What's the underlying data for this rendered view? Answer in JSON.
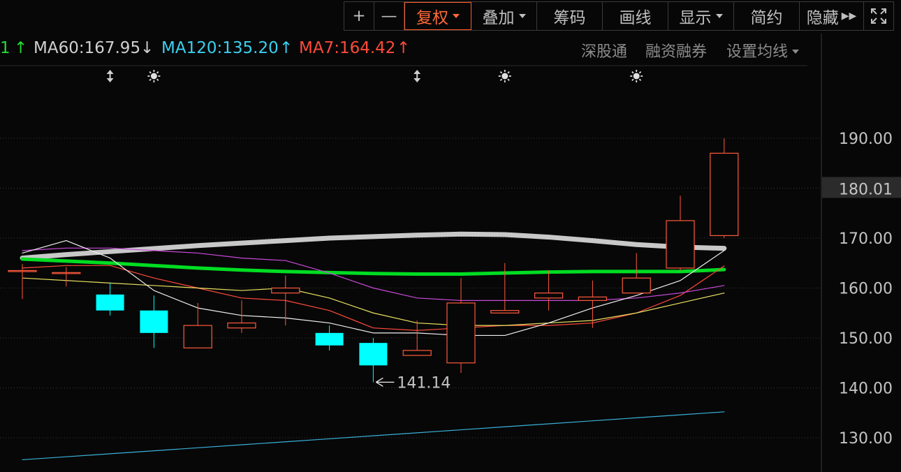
{
  "toolbar": {
    "zoom_in": "+",
    "zoom_out": "—",
    "fuquan": "复权",
    "diejia": "叠加",
    "chouma": "筹码",
    "huaxian": "画线",
    "xianshi": "显示",
    "jianyue": "简约",
    "yincang": "隐藏"
  },
  "ma_legend": {
    "ma_cut": "1",
    "ma_cut_arrow": "↑",
    "ma60": "MA60:167.95",
    "ma60_arrow": "↓",
    "ma120": "MA120:135.20",
    "ma120_arrow": "↑",
    "ma7": "MA7:164.42",
    "ma7_arrow": "↑"
  },
  "right_menu": {
    "sgt": "深股通",
    "rzrq": "融资融券",
    "settings": "设置均线"
  },
  "colors": {
    "up": "#ff5a3c",
    "down": "#00ffff",
    "ma_green": "#00dd22",
    "ma60_grey": "#c8c8c8",
    "ma120_cyan": "#3ab0d8",
    "ma7_red": "#ff4a3a",
    "magenta": "#c84ad8",
    "yellow": "#e8e060",
    "white_line": "#f0f0f0",
    "axis_bg": "#070707",
    "grid": "#3a3a3a"
  },
  "chart_data": {
    "type": "candlestick",
    "y_ticks": [
      "190.00",
      "180.00",
      "170.00",
      "160.00",
      "150.00",
      "140.00",
      "130.00"
    ],
    "ylim": [
      125,
      197
    ],
    "current_price": "180.01",
    "low_annotation": "141.14",
    "candles": [
      {
        "o": 163.5,
        "c": 163.5,
        "h": 164.8,
        "l": 157.8
      },
      {
        "o": 163.1,
        "c": 163.1,
        "h": 164.2,
        "l": 160.3
      },
      {
        "o": 158.7,
        "c": 155.5,
        "h": 161.0,
        "l": 154.5
      },
      {
        "o": 155.5,
        "c": 151.0,
        "h": 158.5,
        "l": 148.0
      },
      {
        "o": 148.0,
        "c": 152.5,
        "h": 157.0,
        "l": 148.0
      },
      {
        "o": 152.0,
        "c": 153.0,
        "h": 157.5,
        "l": 151.0
      },
      {
        "o": 159.0,
        "c": 160.0,
        "h": 162.5,
        "l": 152.5
      },
      {
        "o": 151.0,
        "c": 148.5,
        "h": 152.5,
        "l": 147.5
      },
      {
        "o": 149.0,
        "c": 144.5,
        "h": 150.0,
        "l": 141.14
      },
      {
        "o": 146.5,
        "c": 147.5,
        "h": 153.5,
        "l": 146.5
      },
      {
        "o": 145.0,
        "c": 157.0,
        "h": 162.0,
        "l": 143.0
      },
      {
        "o": 155.0,
        "c": 155.5,
        "h": 165.0,
        "l": 155.0
      },
      {
        "o": 158.0,
        "c": 159.0,
        "h": 163.5,
        "l": 155.5
      },
      {
        "o": 157.5,
        "c": 158.2,
        "h": 161.5,
        "l": 152.0
      },
      {
        "o": 159.0,
        "c": 162.0,
        "h": 167.0,
        "l": 159.0
      },
      {
        "o": 164.0,
        "c": 173.5,
        "h": 178.5,
        "l": 163.5
      },
      {
        "o": 170.5,
        "c": 187.0,
        "h": 190.0,
        "l": 170.0
      }
    ],
    "marks": [
      {
        "type": "updown",
        "index": 2
      },
      {
        "type": "sun",
        "index": 3
      },
      {
        "type": "updown",
        "index": 9
      },
      {
        "type": "sun",
        "index": 11
      },
      {
        "type": "sun",
        "index": 14
      }
    ],
    "ma_lines": [
      {
        "name": "MA60",
        "values": [
          166.0,
          166.7,
          167.3,
          167.9,
          168.5,
          169.0,
          169.5,
          170.0,
          170.3,
          170.6,
          170.8,
          170.7,
          170.2,
          169.5,
          168.7,
          168.2,
          167.95
        ]
      },
      {
        "name": "MA_green",
        "values": [
          165.8,
          165.4,
          165.0,
          164.5,
          164.0,
          163.6,
          163.3,
          163.1,
          162.9,
          162.8,
          162.8,
          163.0,
          163.2,
          163.3,
          163.3,
          163.3,
          163.7
        ]
      },
      {
        "name": "MA120",
        "values": [
          125.6,
          126.2,
          126.8,
          127.4,
          128.0,
          128.6,
          129.2,
          129.8,
          130.4,
          131.0,
          131.6,
          132.2,
          132.8,
          133.4,
          134.0,
          134.6,
          135.2
        ]
      },
      {
        "name": "MA7",
        "values": [
          164.0,
          164.5,
          164.5,
          162.0,
          160.0,
          158.0,
          157.5,
          155.5,
          152.0,
          151.5,
          152.0,
          152.5,
          152.5,
          153.0,
          155.0,
          158.5,
          164.42
        ]
      },
      {
        "name": "magenta",
        "values": [
          167.5,
          168.0,
          168.0,
          167.5,
          167.0,
          166.0,
          165.5,
          163.0,
          160.0,
          158.0,
          157.5,
          157.5,
          157.5,
          157.5,
          158.0,
          159.0,
          160.5
        ]
      },
      {
        "name": "yellow",
        "values": [
          162.0,
          161.5,
          161.0,
          160.5,
          160.0,
          159.5,
          160.0,
          158.0,
          155.0,
          153.0,
          152.5,
          152.5,
          153.0,
          153.5,
          155.0,
          157.0,
          159.0
        ]
      },
      {
        "name": "white",
        "values": [
          167.0,
          169.5,
          166.0,
          159.5,
          156.0,
          154.5,
          154.0,
          153.0,
          151.0,
          151.0,
          150.5,
          150.5,
          153.0,
          156.0,
          158.5,
          161.5,
          167.5
        ]
      }
    ]
  }
}
